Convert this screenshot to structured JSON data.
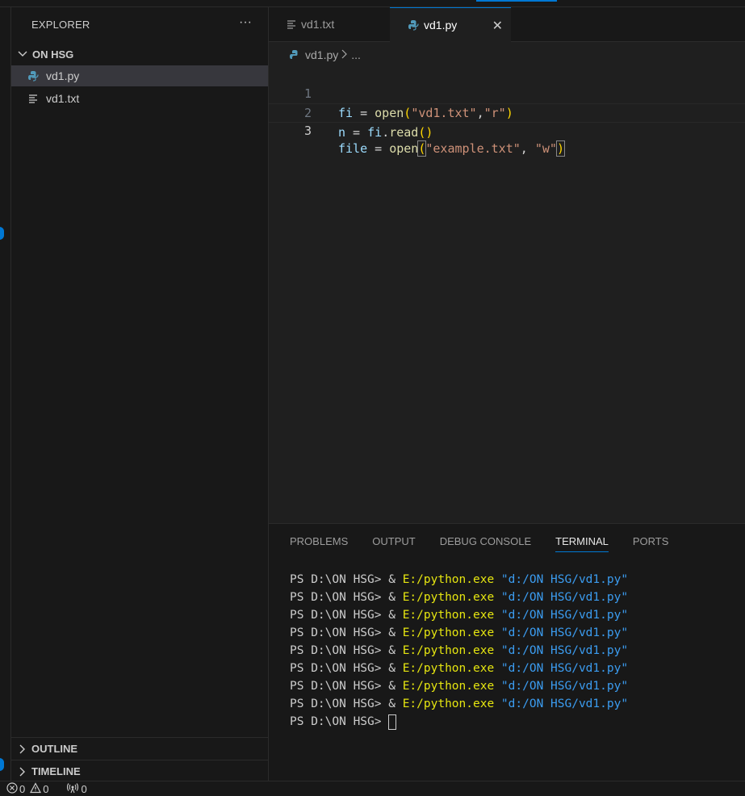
{
  "explorer": {
    "title": "EXPLORER",
    "more_label": "···",
    "folder": "ON HSG",
    "files": [
      {
        "name": "vd1.py",
        "icon": "python-file-icon"
      },
      {
        "name": "vd1.txt",
        "icon": "text-file-icon"
      }
    ],
    "sections": [
      "OUTLINE",
      "TIMELINE"
    ]
  },
  "tabs": [
    {
      "label": "vd1.txt",
      "icon": "text-file-icon"
    },
    {
      "label": "vd1.py",
      "icon": "python-file-icon",
      "close": "✕"
    }
  ],
  "breadcrumb": {
    "file": "vd1.py",
    "rest": "..."
  },
  "editor": {
    "line_numbers": [
      "1",
      "2",
      "3"
    ]
  },
  "panel": {
    "tabs": [
      "PROBLEMS",
      "OUTPUT",
      "DEBUG CONSOLE",
      "TERMINAL",
      "PORTS"
    ],
    "active_tab": "TERMINAL",
    "prompt": "PS D:\\ON HSG> ",
    "command": "& ",
    "exe": "E:/python.exe",
    "arg": "\"d:/ON HSG/vd1.py\""
  },
  "status": {
    "errors": "0",
    "warnings": "0",
    "ports": "0"
  },
  "colors": {
    "accent": "#0078d4",
    "editor_bg": "#1f1f1f",
    "sidebar_bg": "#181818"
  }
}
